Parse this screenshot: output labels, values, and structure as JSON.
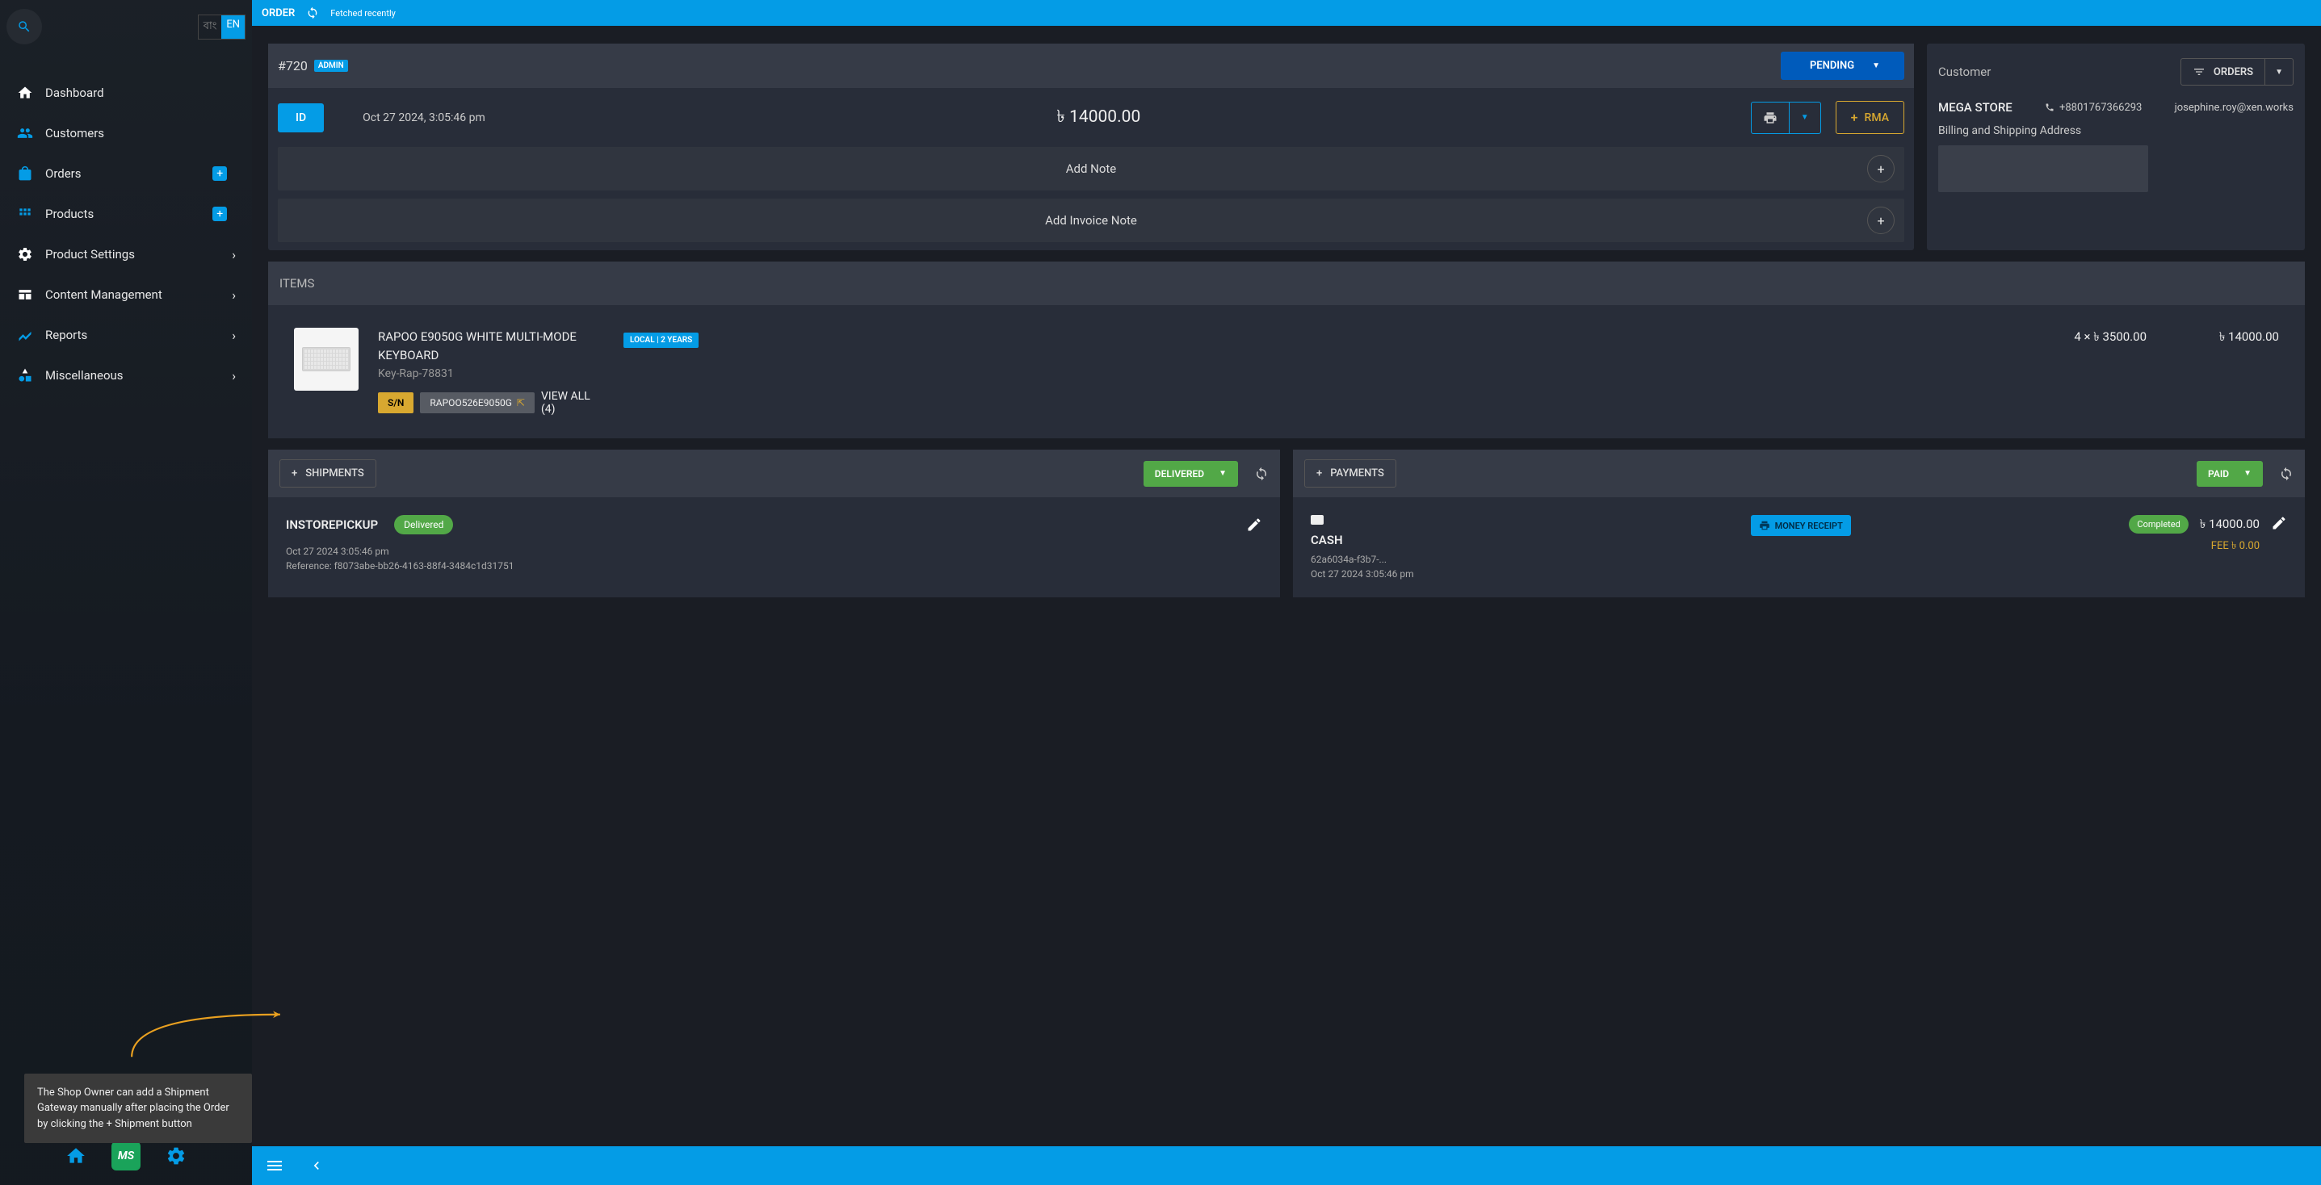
{
  "topbar": {
    "label": "ORDER",
    "fetched": "Fetched recently"
  },
  "lang": {
    "bn": "বাং",
    "en": "EN"
  },
  "nav": {
    "dashboard": "Dashboard",
    "customers": "Customers",
    "orders": "Orders",
    "products": "Products",
    "product_settings": "Product Settings",
    "content_mgmt": "Content Management",
    "reports": "Reports",
    "misc": "Miscellaneous"
  },
  "order": {
    "id": "#720",
    "admin_badge": "ADMIN",
    "status": "PENDING",
    "id_chip": "ID",
    "date": "Oct 27 2024, 3:05:46 pm",
    "total": "৳ 14000.00",
    "rma": "RMA",
    "add_note": "Add Note",
    "add_invoice_note": "Add Invoice Note"
  },
  "customer": {
    "label": "Customer",
    "orders_btn": "ORDERS",
    "name": "MEGA STORE",
    "phone": "+8801767366293",
    "email": "josephine.roy@xen.works",
    "addr_label": "Billing and Shipping Address"
  },
  "items": {
    "label": "ITEMS",
    "item": {
      "name": "RAPOO E9050G WHITE MULTI-MODE KEYBOARD",
      "sku": "Key-Rap-78831",
      "sn_label": "S/N",
      "sn_value": "RAPOO526E9050G",
      "view_all": "VIEW ALL (4)",
      "warranty": "LOCAL | 2 YEARS",
      "qty_price": "4 × ৳ 3500.00",
      "line_total": "৳ 14000.00"
    }
  },
  "shipments": {
    "add_btn": "SHIPMENTS",
    "status": "DELIVERED",
    "method": "INSTOREPICKUP",
    "delivered_badge": "Delivered",
    "date": "Oct 27 2024 3:05:46 pm",
    "reference": "Reference: f8073abe-bb26-4163-88f4-3484c1d31751"
  },
  "payments": {
    "add_btn": "PAYMENTS",
    "status": "PAID",
    "type": "CASH",
    "money_receipt": "MONEY RECEIPT",
    "completed": "Completed",
    "ref": "62a6034a-f3b7-...",
    "date": "Oct 27 2024 3:05:46 pm",
    "amount": "৳ 14000.00",
    "fee": "FEE ৳ 0.00"
  },
  "callout": "The Shop Owner can add a Shipment Gateway manually after placing the Order by clicking the + Shipment button"
}
